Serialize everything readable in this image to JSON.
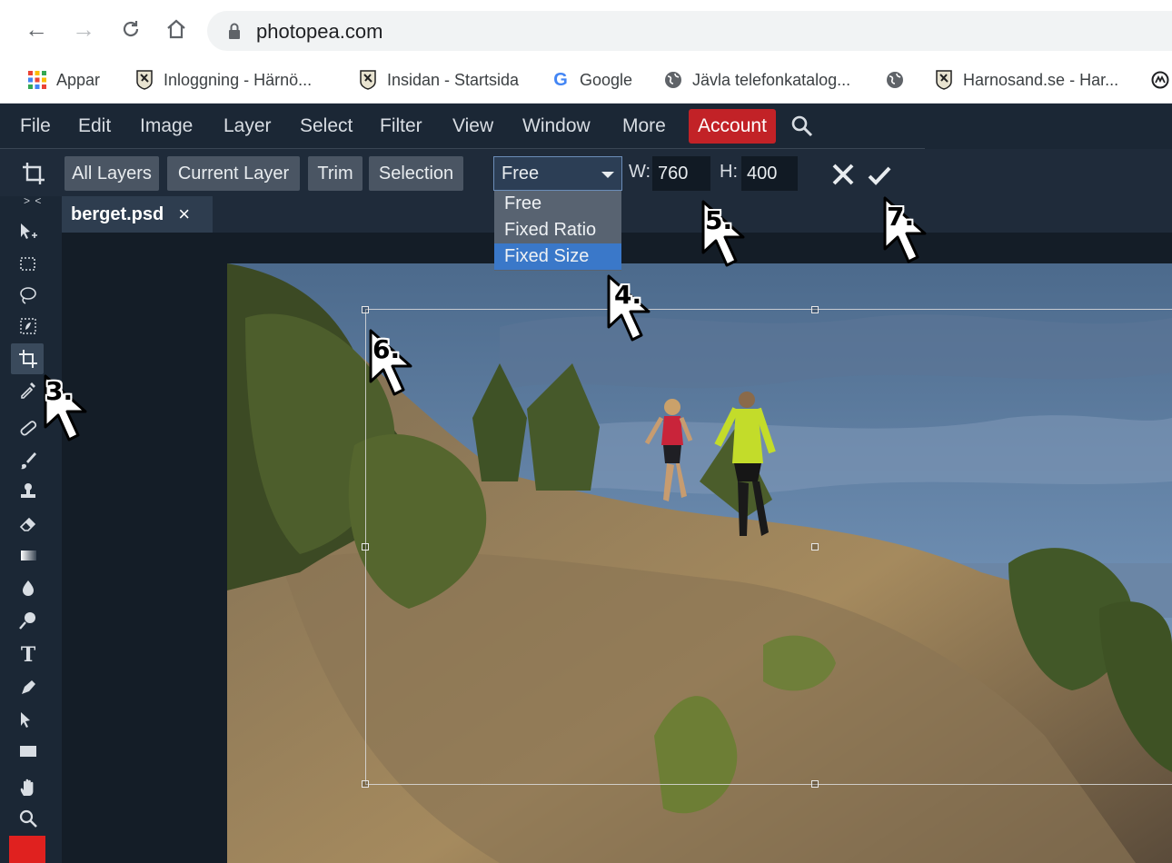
{
  "browser": {
    "url": "photopea.com",
    "bookmarks": [
      {
        "label": "Appar",
        "icon": "apps-grid-icon"
      },
      {
        "label": "Inloggning - Härnö...",
        "icon": "harnosand-crest-icon"
      },
      {
        "label": "Insidan - Startsida",
        "icon": "harnosand-crest-icon"
      },
      {
        "label": "Google",
        "icon": "google-g-icon"
      },
      {
        "label": "Jävla telefonkatalog...",
        "icon": "globe-icon"
      },
      {
        "label": "",
        "icon": "globe-icon"
      },
      {
        "label": "Harnosand.se - Har...",
        "icon": "harnosand-crest-icon"
      }
    ]
  },
  "menu": {
    "items": [
      "File",
      "Edit",
      "Image",
      "Layer",
      "Select",
      "Filter",
      "View",
      "Window",
      "More"
    ],
    "account": "Account"
  },
  "options": {
    "buttons": [
      "All Layers",
      "Current Layer",
      "Trim",
      "Selection"
    ],
    "mode": "Free",
    "width_label": "W:",
    "width_value": "760",
    "height_label": "H:",
    "height_value": "400"
  },
  "dropdown": {
    "options": [
      "Free",
      "Fixed Ratio",
      "Fixed Size"
    ],
    "highlighted": "Fixed Size"
  },
  "document": {
    "tab_name": "berget.psd",
    "close": "×"
  },
  "toolbar": {
    "collapse": "> <",
    "tools": [
      "move-tool-icon",
      "marquee-tool-icon",
      "lasso-tool-icon",
      "quick-select-tool-icon",
      "crop-tool-icon",
      "eyedropper-tool-icon",
      "healing-brush-tool-icon",
      "brush-tool-icon",
      "clone-stamp-tool-icon",
      "eraser-tool-icon",
      "gradient-tool-icon",
      "blur-tool-icon",
      "dodge-tool-icon",
      "text-tool-icon",
      "pen-tool-icon",
      "path-select-tool-icon",
      "shape-tool-icon",
      "hand-tool-icon",
      "zoom-tool-icon"
    ],
    "foreground_color": "#e0211f"
  },
  "annotations": {
    "step3": "3.",
    "step4": "4.",
    "step5": "5.",
    "step6": "6.",
    "step7": "7."
  }
}
